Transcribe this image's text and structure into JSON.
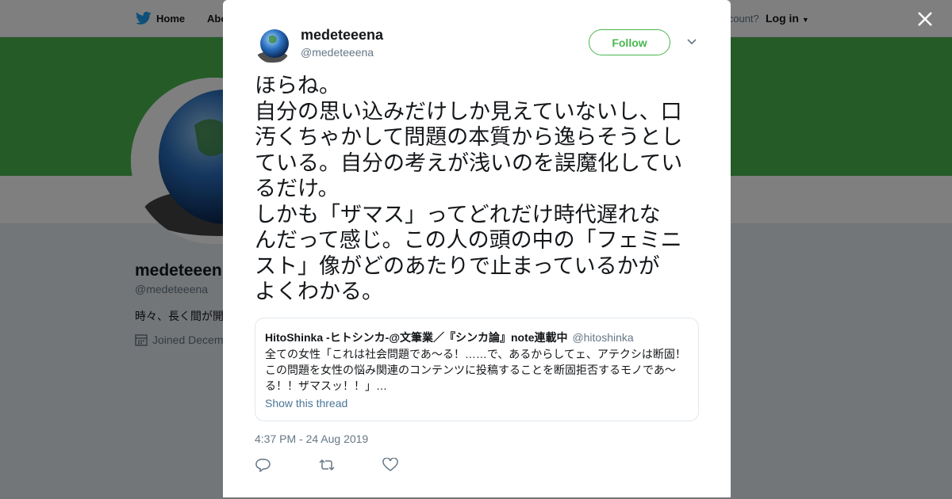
{
  "topnav": {
    "home_label": "Home",
    "about_label": "Abo",
    "account_prompt": "account?",
    "login_label": "Log in"
  },
  "profile": {
    "display_name": "medeteeen",
    "handle": "@medeteeena",
    "bio": "時々、長く間が開",
    "joined": "Joined Decem"
  },
  "modal": {
    "author": {
      "display_name": "medeteeena",
      "handle": "@medeteeena"
    },
    "follow_label": "Follow",
    "tweet_lines": [
      "ほらね。",
      "自分の思い込みだけしか見えていないし、口",
      "汚くちゃかして問題の本質から逸らそうとし",
      "ている。自分の考えが浅いのを誤魔化してい",
      "るだけ。",
      "しかも「ザマス」ってどれだけ時代遅れな",
      "んだって感じ。この人の頭の中の「フェミニ",
      "スト」像がどのあたりで止まっているかが",
      "よくわかる。"
    ],
    "quoted": {
      "display_name": "HitoShinka -ヒトシンカ-@文筆業／『シンカ論』note連載中",
      "handle": "@hitoshinka",
      "body_lines": [
        "全ての女性「これは社会問題であ～る！……で、あるからしてェ、アテクシは断固！",
        "この問題を女性の悩み関連のコンテンツに投稿することを断固拒否するモノであ～",
        "る！！ザマスッ！！」…"
      ],
      "show_thread_label": "Show this thread"
    },
    "timestamp": "4:37 PM - 24 Aug 2019"
  },
  "colors": {
    "brand_green": "#4ab74f",
    "text_primary": "#14171a",
    "text_secondary": "#657786",
    "link_blue": "#4b7596",
    "twitter_blue": "#1da1f2"
  },
  "icons": [
    "twitter-bird-icon",
    "close-icon",
    "chevron-down-icon",
    "calendar-icon",
    "reply-icon",
    "retweet-icon",
    "like-icon"
  ]
}
